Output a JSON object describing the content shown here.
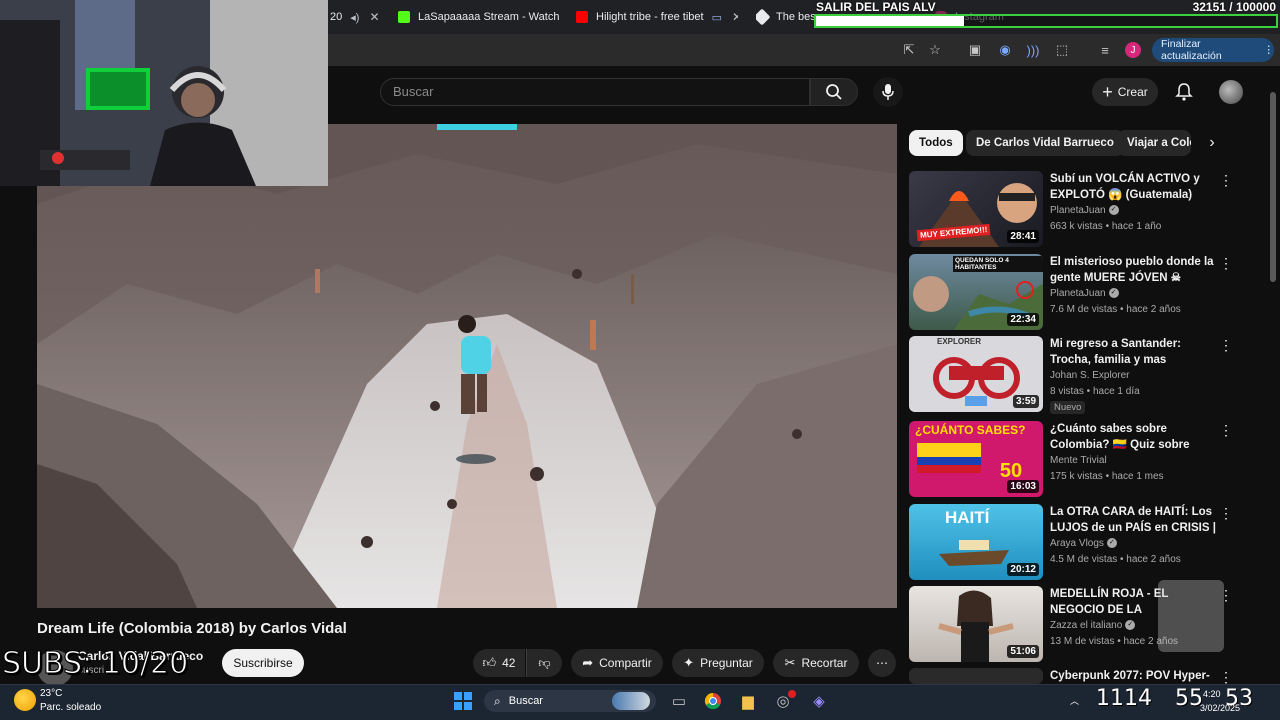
{
  "browser": {
    "tabs": [
      {
        "label": "20",
        "fav_color": "#444444"
      },
      {
        "label": "LaSapaaaaa Stream - Watch",
        "fav_color": "#53fc18"
      },
      {
        "label": "Hilight tribe - free tibet",
        "fav_color": "#ff0000"
      },
      {
        "label": "The best",
        "fav_color": "#e8eaed"
      },
      {
        "label": "Instagram",
        "fav_color": "#d62976"
      }
    ],
    "update_button": "Finalizar actualización",
    "profile_initial": "J"
  },
  "overlay": {
    "goal_text": "SALIR DEL PAIS ALV",
    "subs_progress": "32151 / 100000",
    "progress_fraction": 0.32151,
    "subs_counter": "SUBS: 10/20"
  },
  "youtube": {
    "search_placeholder": "Buscar",
    "create_label": "Crear",
    "video_title": "Dream Life (Colombia 2018) by Carlos Vidal",
    "channel_name": "Carlos Vidal Barrueco",
    "channel_subs": "suscri",
    "subscribe_label": "Suscribirse",
    "likes": "42",
    "share_label": "Compartir",
    "ask_label": "Preguntar",
    "clip_label": "Recortar",
    "chips": [
      "Todos",
      "De Carlos Vidal Barrueco",
      "Viajar a Colombia"
    ],
    "recommendations": [
      {
        "title": "Subí un VOLCÁN ACTIVO y EXPLOTÓ 😱 (Guatemala)",
        "channel": "PlanetaJuan",
        "verified": true,
        "meta": "663 k vistas • hace 1 año",
        "duration": "28:41",
        "thumb_text": "MUY EXTREMO!!!",
        "badge": ""
      },
      {
        "title": "El misterioso pueblo donde la gente MUERE JÓVEN ☠",
        "channel": "PlanetaJuan",
        "verified": true,
        "meta": "7.6 M de vistas • hace 2 años",
        "duration": "22:34",
        "thumb_text": "QUEDAN SOLO 4 HABITANTES",
        "badge": ""
      },
      {
        "title": "Mi regreso a Santander: Trocha, familia y mas  aventuras con ...",
        "channel": "Johan S. Explorer",
        "verified": false,
        "meta": "8 vistas • hace 1 día",
        "duration": "3:59",
        "thumb_text": "EXPLORER",
        "badge": "Nuevo"
      },
      {
        "title": "¿Cuánto sabes sobre Colombia? 🇨🇴 Quiz sobre Colombia",
        "channel": "Mente Trivial",
        "verified": false,
        "meta": "175 k vistas • hace 1 mes",
        "duration": "16:03",
        "thumb_text": "¿CUÁNTO SABES?",
        "badge": ""
      },
      {
        "title": "La OTRA CARA de HAITÍ: Los LUJOS de un PAÍS en CRISIS | ...",
        "channel": "Araya Vlogs",
        "verified": true,
        "meta": "4.5 M de vistas • hace 2 años",
        "duration": "20:12",
        "thumb_text": "HAITÍ",
        "badge": ""
      },
      {
        "title": "MEDELLÍN ROJA - EL NEGOCIO DE LA PROSTITUCIÓN",
        "channel": "Zazza el italiano",
        "verified": true,
        "meta": "13 M de vistas • hace 2 años",
        "duration": "51:06",
        "thumb_text": "",
        "badge": ""
      },
      {
        "title": "Cyberpunk 2077: POV Hyper-",
        "channel": "",
        "verified": false,
        "meta": "",
        "duration": "",
        "thumb_text": "",
        "badge": ""
      }
    ]
  },
  "taskbar": {
    "temperature": "23°C",
    "weather": "Parc. soleado",
    "search_label": "Buscar",
    "overlay_numbers": [
      "1114",
      "55",
      "53"
    ],
    "time": "4:20",
    "date": "3/02/2025"
  }
}
